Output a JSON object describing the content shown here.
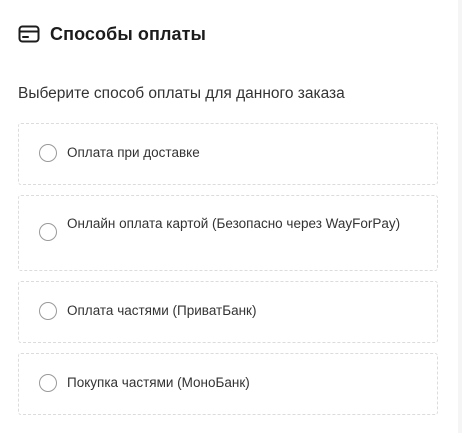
{
  "payment": {
    "title": "Способы оплаты",
    "icon": "credit-card-icon",
    "subtitle": "Выберите способ оплаты для данного заказа",
    "options": [
      {
        "label": "Оплата при доставке",
        "selected": false
      },
      {
        "label": "Онлайн оплата картой (Безопасно через WayForPay)",
        "selected": false
      },
      {
        "label": "Оплата частями (ПриватБанк)",
        "selected": false
      },
      {
        "label": "Покупка частями (МоноБанк)",
        "selected": false
      }
    ]
  }
}
